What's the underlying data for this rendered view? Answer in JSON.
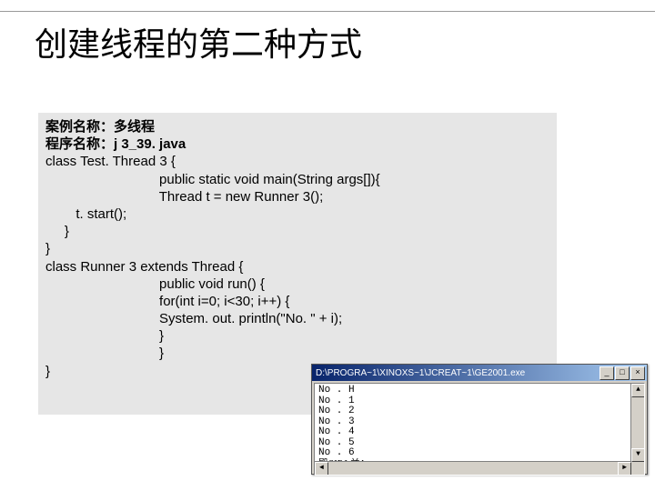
{
  "slide": {
    "title": "创建线程的第二种方式"
  },
  "code": {
    "l1": "案例名称：多线程",
    "l2": "程序名称：j 3_39. java",
    "l3": "class Test. Thread 3 {",
    "l4": "                              public static void main(String args[]){",
    "l5": "                              Thread t = new Runner 3();",
    "l6": "        t. start();",
    "l7": "     }",
    "l8": "}",
    "l9": "class Runner 3 extends Thread {",
    "l10": "                              public void run() {",
    "l11": "                              for(int i=0; i<30; i++) {",
    "l12": "                              System. out. println(\"No. \" + i);",
    "l13": "                              }",
    "l14": "                              }",
    "l15": "}"
  },
  "console": {
    "title": "D:\\PROGRA~1\\XINOXS~1\\JCREAT~1\\GE2001.exe",
    "output": [
      "No . H",
      "No . 1",
      "No . 2",
      "No . 3",
      "No . 4",
      "No . 5",
      "No . 6"
    ],
    "corrupt": "殿SIP.I.兰：",
    "buttons": {
      "min": "_",
      "max": "□",
      "close": "×"
    },
    "scroll": {
      "up": "▲",
      "down": "▼",
      "left": "◄",
      "right": "►"
    }
  }
}
